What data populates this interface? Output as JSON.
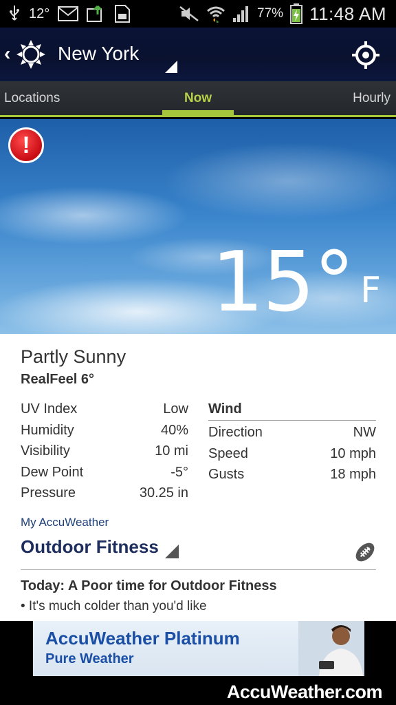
{
  "status_bar": {
    "temp": "12°",
    "battery_percent": "77%",
    "time": "11:48 AM",
    "icons": [
      "usb-icon",
      "mail-icon",
      "upload-icon",
      "sd-card-icon",
      "mute-icon",
      "wifi-icon",
      "signal-icon",
      "battery-icon"
    ]
  },
  "header": {
    "city": "New York",
    "icons": [
      "back-chevron-icon",
      "sun-icon",
      "locate-icon"
    ]
  },
  "tabs": [
    {
      "label": "Locations"
    },
    {
      "label": "Now"
    },
    {
      "label": "Hourly"
    }
  ],
  "hero": {
    "temperature": "15°",
    "unit": "F"
  },
  "current": {
    "condition": "Partly Sunny",
    "realfeel": "RealFeel 6°",
    "details": [
      {
        "label": "UV Index",
        "value": "Low"
      },
      {
        "label": "Humidity",
        "value": "40%"
      },
      {
        "label": "Visibility",
        "value": "10 mi"
      },
      {
        "label": "Dew Point",
        "value": "-5°"
      },
      {
        "label": "Pressure",
        "value": "30.25 in"
      }
    ],
    "wind": {
      "title": "Wind",
      "rows": [
        {
          "label": "Direction",
          "value": "NW"
        },
        {
          "label": "Speed",
          "value": "10 mph"
        },
        {
          "label": "Gusts",
          "value": "18 mph"
        }
      ]
    }
  },
  "my_accuweather": {
    "label": "My AccuWeather",
    "selected": "Outdoor Fitness",
    "today_text": "Today: A Poor time for Outdoor Fitness",
    "bullet": "• It's much colder than you'd like"
  },
  "ad": {
    "title": "AccuWeather Platinum",
    "subtitle": "Pure Weather"
  },
  "footer": {
    "brand": "AccuWeather.com"
  },
  "colors": {
    "accent_green": "#a6c63b",
    "header_navy": "#0b1336",
    "alert_red": "#c80c14",
    "link_blue": "#1c3f7a"
  }
}
